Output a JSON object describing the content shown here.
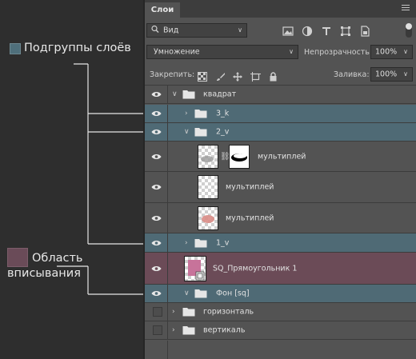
{
  "legend": {
    "subgroups_label": "Подгруппы слоёв",
    "clip_area_line1": "Область",
    "clip_area_line2": "вписывания"
  },
  "panel": {
    "tab_label": "Слои",
    "filter_kind": "Вид",
    "blend_mode": "Умножение",
    "opacity_label": "Непрозрачность:",
    "opacity_value": "100%",
    "lock_label": "Закрепить:",
    "fill_label": "Заливка:",
    "fill_value": "100%"
  },
  "layers": [
    {
      "name": "квадрат",
      "type": "group",
      "expanded": true,
      "visible": true,
      "indent": 0
    },
    {
      "name": "3_k",
      "type": "group",
      "expanded": false,
      "visible": true,
      "indent": 1
    },
    {
      "name": "2_v",
      "type": "group",
      "expanded": true,
      "visible": true,
      "indent": 1
    },
    {
      "name": "мультиплей",
      "type": "layer-mask",
      "visible": true,
      "indent": 2
    },
    {
      "name": "мультиплей",
      "type": "layer",
      "visible": true,
      "indent": 2
    },
    {
      "name": "мультиплей",
      "type": "layer",
      "visible": true,
      "indent": 2
    },
    {
      "name": "1_v",
      "type": "group",
      "expanded": false,
      "visible": true,
      "indent": 1
    },
    {
      "name": "SQ_Прямоугольник 1",
      "type": "shape",
      "visible": true,
      "indent": 1
    },
    {
      "name": "Фон [sq]",
      "type": "group",
      "expanded": true,
      "visible": true,
      "indent": 1
    },
    {
      "name": "горизонталь",
      "type": "group",
      "expanded": false,
      "visible": false,
      "indent": 0
    },
    {
      "name": "вертикаль",
      "type": "group",
      "expanded": false,
      "visible": false,
      "indent": 0
    }
  ],
  "colors": {
    "subgroup_highlight": "#4f6a75",
    "clip_highlight": "#6b4b57",
    "panel_bg": "#535353"
  }
}
